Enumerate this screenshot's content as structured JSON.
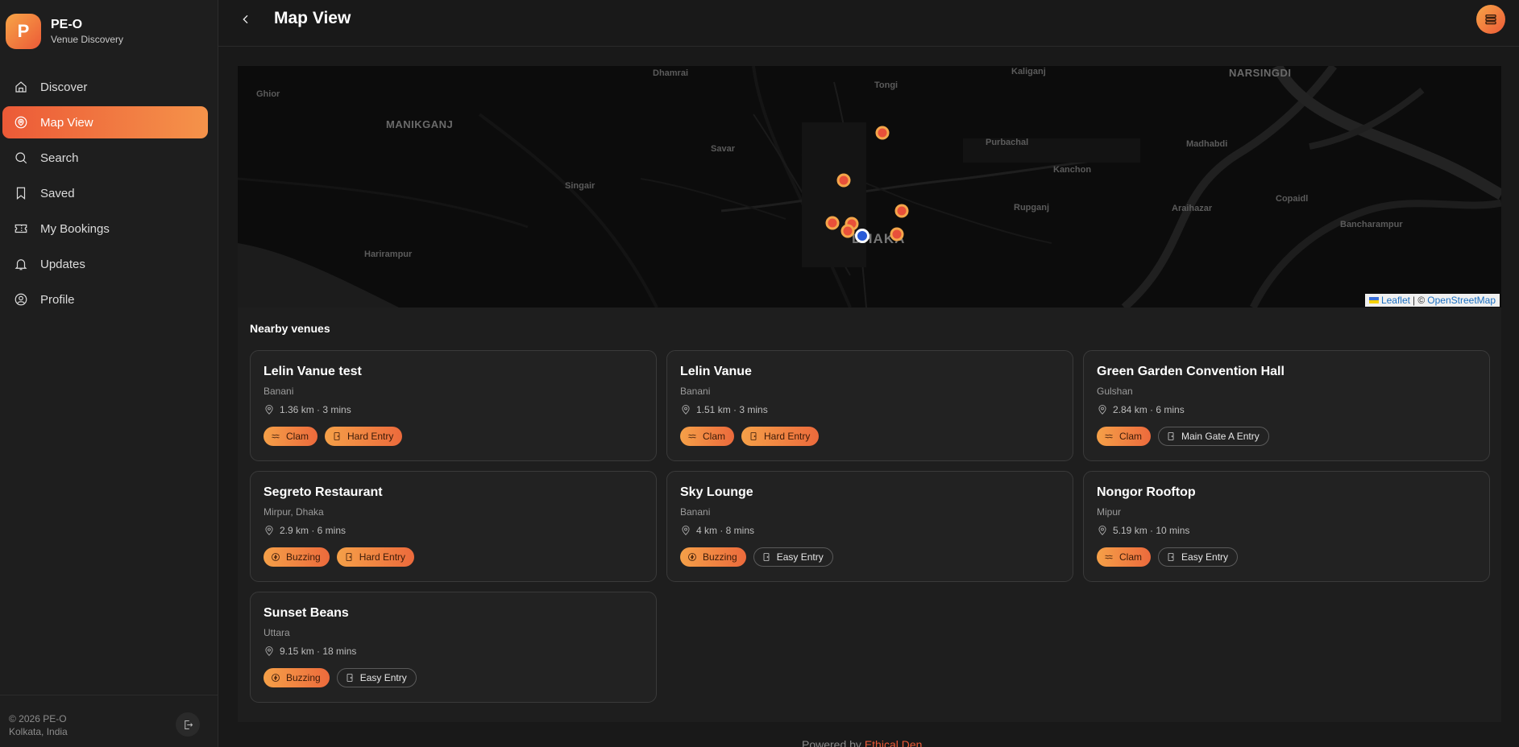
{
  "brand": {
    "logo_letter": "P",
    "name": "PE-O",
    "subtitle": "Venue Discovery"
  },
  "nav": [
    {
      "label": "Discover",
      "icon": "home-icon",
      "active": false
    },
    {
      "label": "Map View",
      "icon": "map-pin-icon",
      "active": true
    },
    {
      "label": "Search",
      "icon": "search-icon",
      "active": false
    },
    {
      "label": "Saved",
      "icon": "bookmark-icon",
      "active": false
    },
    {
      "label": "My Bookings",
      "icon": "ticket-icon",
      "active": false
    },
    {
      "label": "Updates",
      "icon": "bell-icon",
      "active": false
    },
    {
      "label": "Profile",
      "icon": "user-icon",
      "active": false
    }
  ],
  "footer": {
    "copyright": "© 2026 PE-O",
    "location": "Kolkata, India"
  },
  "header": {
    "title": "Map View"
  },
  "map": {
    "places": [
      "Dhamrai",
      "Tongi",
      "Kaliganj",
      "NARSINGDI",
      "Ghior",
      "MANIKGANJ",
      "Savar",
      "Purbachal",
      "Madhabdi",
      "Kanchon",
      "Singair",
      "Rupganj",
      "Araihazar",
      "Copaidl",
      "Bancharampur",
      "DHAKA",
      "Harirampur"
    ],
    "attribution_leaflet": "Leaflet",
    "attribution_sep": "| ©",
    "attribution_osm": "OpenStreetMap"
  },
  "nearby": {
    "title": "Nearby venues",
    "venues": [
      {
        "name": "Lelin Vanue test",
        "area": "Banani",
        "distance": "1.36 km · 3 mins",
        "vibe": "Clam",
        "vibe_icon": "waves-icon",
        "entry": "Hard Entry",
        "entry_style": "orange"
      },
      {
        "name": "Lelin Vanue",
        "area": "Banani",
        "distance": "1.51 km · 3 mins",
        "vibe": "Clam",
        "vibe_icon": "waves-icon",
        "entry": "Hard Entry",
        "entry_style": "orange"
      },
      {
        "name": "Green Garden Convention Hall",
        "area": "Gulshan",
        "distance": "2.84 km · 6 mins",
        "vibe": "Clam",
        "vibe_icon": "waves-icon",
        "entry": "Main Gate A Entry",
        "entry_style": "outline"
      },
      {
        "name": "Segreto Restaurant",
        "area": "Mirpur, Dhaka",
        "distance": "2.9 km · 6 mins",
        "vibe": "Buzzing",
        "vibe_icon": "zap-icon",
        "entry": "Hard Entry",
        "entry_style": "orange"
      },
      {
        "name": "Sky Lounge",
        "area": "Banani",
        "distance": "4 km · 8 mins",
        "vibe": "Buzzing",
        "vibe_icon": "zap-icon",
        "entry": "Easy Entry",
        "entry_style": "outline"
      },
      {
        "name": "Nongor Rooftop",
        "area": "Mipur",
        "distance": "5.19 km · 10 mins",
        "vibe": "Clam",
        "vibe_icon": "waves-icon",
        "entry": "Easy Entry",
        "entry_style": "outline"
      },
      {
        "name": "Sunset Beans",
        "area": "Uttara",
        "distance": "9.15 km · 18 mins",
        "vibe": "Buzzing",
        "vibe_icon": "zap-icon",
        "entry": "Easy Entry",
        "entry_style": "outline"
      }
    ]
  },
  "powered_by": {
    "prefix": "Powered by",
    "name": "Ethical Den"
  },
  "colors": {
    "accent_start": "#ec5a37",
    "accent_end": "#f5a048",
    "background": "#191919",
    "user_marker": "#2a5bd7"
  }
}
